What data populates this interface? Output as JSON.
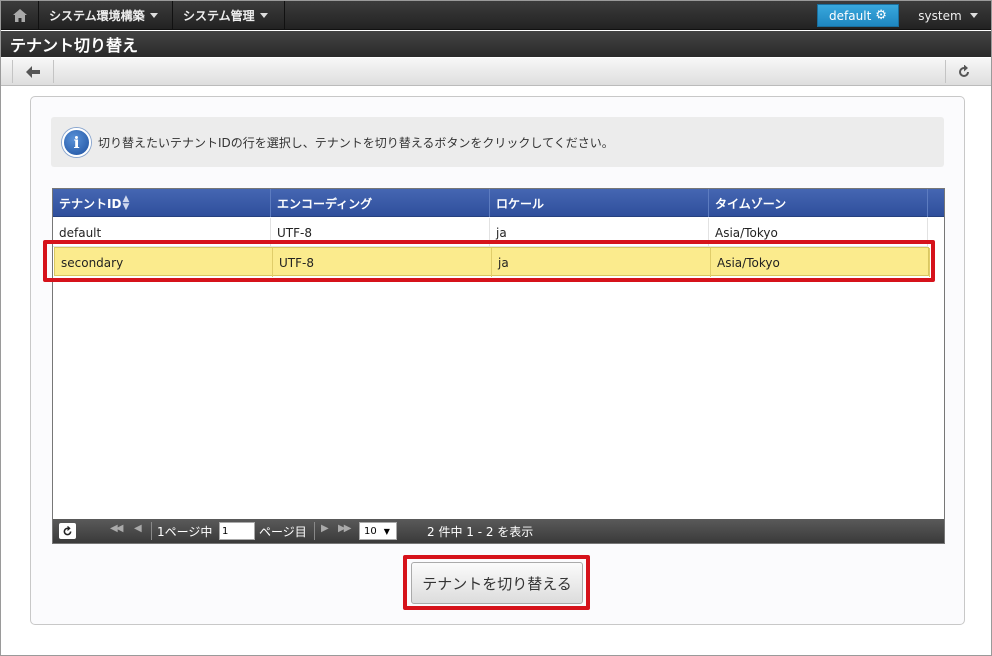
{
  "nav": {
    "menu1": "システム環境構築",
    "menu2": "システム管理",
    "tenant": "default",
    "user": "system"
  },
  "title": "テナント切り替え",
  "info_message": "切り替えたいテナントIDの行を選択し、テナントを切り替えるボタンをクリックしてください。",
  "grid": {
    "columns": [
      "テナントID",
      "エンコーディング",
      "ロケール",
      "タイムゾーン"
    ],
    "rows": [
      {
        "id": "default",
        "encoding": "UTF-8",
        "locale": "ja",
        "timezone": "Asia/Tokyo",
        "selected": false
      },
      {
        "id": "secondary",
        "encoding": "UTF-8",
        "locale": "ja",
        "timezone": "Asia/Tokyo",
        "selected": true
      }
    ],
    "pager": {
      "page_prefix": "1ページ中",
      "page_value": "1",
      "page_suffix": "ページ目",
      "page_size": "10",
      "summary": "2 件中 1 - 2 を表示"
    }
  },
  "switch_button": "テナントを切り替える",
  "colors": {
    "header": "#2f4f9c",
    "selected_row": "#fbeb8d",
    "highlight": "#d6121b",
    "tenant_button": "#1e86c0"
  }
}
